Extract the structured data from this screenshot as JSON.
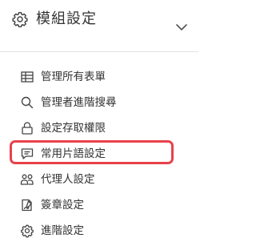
{
  "header": {
    "title": "模組設定",
    "icon": "gear-icon",
    "toggle_icon": "chevron-down-icon"
  },
  "menu": {
    "items": [
      {
        "label": "管理所有表單",
        "icon": "table-icon"
      },
      {
        "label": "管理者進階搜尋",
        "icon": "search-icon"
      },
      {
        "label": "設定存取權限",
        "icon": "lock-icon"
      },
      {
        "label": "常用片語設定",
        "icon": "chat-icon",
        "highlighted": true
      },
      {
        "label": "代理人設定",
        "icon": "users-icon"
      },
      {
        "label": "簽章設定",
        "icon": "signature-icon"
      },
      {
        "label": "進階設定",
        "icon": "gear-icon"
      }
    ]
  },
  "colors": {
    "text": "#333333",
    "highlight_border": "#e8424a",
    "divider": "#e2e2e2"
  }
}
